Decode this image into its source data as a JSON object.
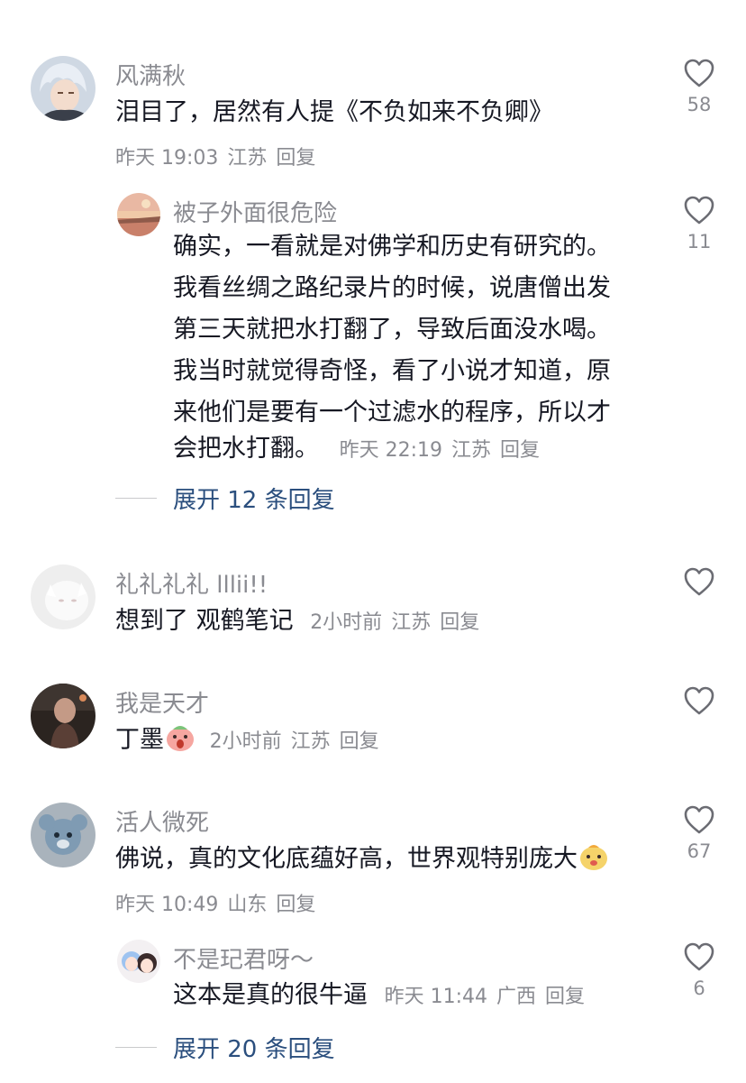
{
  "comments": [
    {
      "username": "风满秋",
      "lines": [
        "泪目了，居然有人提《不负如来不负卿》"
      ],
      "time": "昨天 19:03",
      "location": "江苏",
      "reply": "回复",
      "likes": "58",
      "replies": [
        {
          "username": "被子外面很危险",
          "lines": [
            "确实，一看就是对佛学和历史有研究的。",
            "我看丝绸之路纪录片的时候，说唐僧出发",
            "第三天就把水打翻了，导致后面没水喝。",
            "我当时就觉得奇怪，看了小说才知道，原",
            "来他们是要有一个过滤水的程序，所以才",
            "会把水打翻。"
          ],
          "time": "昨天 22:19",
          "location": "江苏",
          "reply": "回复",
          "likes": "11"
        }
      ],
      "expand_label": "展开 12 条回复"
    },
    {
      "username": "礼礼礼礼 lllii!!",
      "lines": [
        "想到了 观鹤笔记"
      ],
      "time": "2小时前",
      "location": "江苏",
      "reply": "回复",
      "likes": ""
    },
    {
      "username": "我是天才",
      "lines": [
        "丁墨"
      ],
      "time": "2小时前",
      "location": "江苏",
      "reply": "回复",
      "likes": ""
    },
    {
      "username": "活人微死",
      "lines": [
        "佛说，真的文化底蕴好高，世界观特别庞大"
      ],
      "time": "昨天 10:49",
      "location": "山东",
      "reply": "回复",
      "likes": "67",
      "replies": [
        {
          "username": "不是玘君呀～",
          "lines": [
            "这本是真的很牛逼"
          ],
          "time": "昨天 11:44",
          "location": "广西",
          "reply": "回复",
          "likes": "6"
        }
      ],
      "expand_label": "展开 20 条回复"
    }
  ],
  "colors": {
    "text": "#161823",
    "secondary": "#8a8b91",
    "expand": "#2b4f7e"
  },
  "icons": [
    "heart-outline-icon",
    "emoji-surprised-icon",
    "emoji-happy-icon"
  ]
}
